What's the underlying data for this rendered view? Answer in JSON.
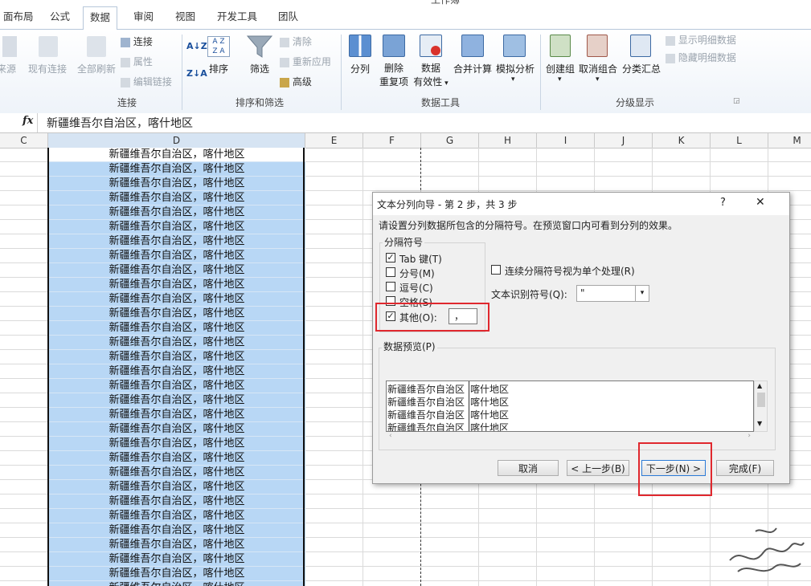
{
  "tabs": [
    "面布局",
    "公式",
    "数据",
    "审阅",
    "视图",
    "开发工具",
    "团队"
  ],
  "title_fragment": "工作簿",
  "ribbon": {
    "groups": {
      "connections": "连接",
      "sort_filter": "排序和筛选",
      "data_tools": "数据工具",
      "outline": "分级显示"
    },
    "buttons": {
      "from_source": "来源",
      "existing_conn": "现有连接",
      "refresh_all": "全部刷新",
      "connections": "连接",
      "properties": "属性",
      "edit_links": "编辑链接",
      "sort": "排序",
      "filter": "筛选",
      "clear": "清除",
      "reapply": "重新应用",
      "advanced": "高级",
      "split": "分列",
      "remove_dup_1": "删除",
      "remove_dup_2": "重复项",
      "validation_1": "数据",
      "validation_2": "有效性",
      "consolidate": "合并计算",
      "whatif": "模拟分析",
      "group": "创建组",
      "ungroup": "取消组合",
      "subtotal": "分类汇总",
      "show_detail": "显示明细数据",
      "hide_detail": "隐藏明细数据"
    }
  },
  "formula_bar": {
    "fx": "fx",
    "value": "新疆维吾尔自治区，喀什地区"
  },
  "columns": [
    "C",
    "D",
    "E",
    "F",
    "G",
    "H",
    "I",
    "J",
    "K",
    "L",
    "M"
  ],
  "cell_value": "新疆维吾尔自治区，喀什地区",
  "dialog": {
    "title": "文本分列向导 - 第 2 步，共 3 步",
    "help": "?",
    "close": "✕",
    "instruction": "请设置分列数据所包含的分隔符号。在预览窗口内可看到分列的效果。",
    "delimiters_label": "分隔符号",
    "options": [
      {
        "label": "Tab 键(T)",
        "checked": true
      },
      {
        "label": "分号(M)",
        "checked": false
      },
      {
        "label": "逗号(C)",
        "checked": false
      },
      {
        "label": "空格(S)",
        "checked": false
      },
      {
        "label": "其他(O):",
        "checked": true
      }
    ],
    "other_value": "，",
    "consecutive_label": "连续分隔符号视为单个处理(R)",
    "consecutive_checked": false,
    "qualifier_label": "文本识别符号(Q):",
    "qualifier_value": "\"",
    "preview_label": "数据预览(P)",
    "preview_rows": [
      [
        "新疆维吾尔自治区",
        "喀什地区"
      ],
      [
        "新疆维吾尔自治区",
        "喀什地区"
      ],
      [
        "新疆维吾尔自治区",
        "喀什地区"
      ],
      [
        "新疆维吾尔自治区",
        "喀什地区"
      ]
    ],
    "buttons": {
      "cancel": "取消",
      "back": "< 上一步(B)",
      "next": "下一步(N) >",
      "finish": "完成(F)"
    }
  },
  "colors": {
    "selection": "#b8d7f5",
    "highlight": "#e0282e",
    "ribbon_border": "#b7c7da"
  }
}
